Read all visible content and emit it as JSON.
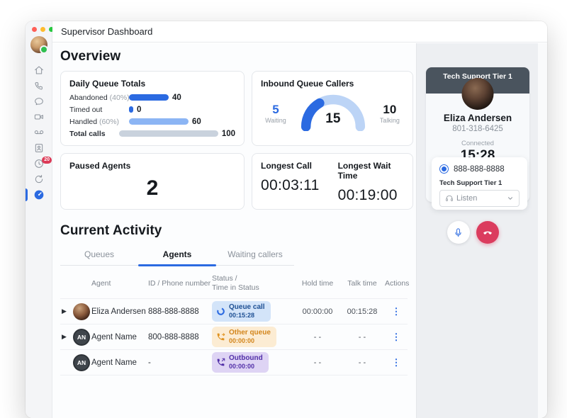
{
  "window": {
    "title": "Supervisor Dashboard"
  },
  "sidebar": {
    "history_badge": "20"
  },
  "overview": {
    "title": "Overview",
    "daily_queue": {
      "title": "Daily Queue Totals",
      "max": 100,
      "rows": [
        {
          "label": "Abandoned",
          "pct": "(40%)",
          "value": "40",
          "value_num": 40
        },
        {
          "label": "Timed out",
          "pct": "",
          "value": "0",
          "value_num": 0
        },
        {
          "label": "Handled",
          "pct": "(60%)",
          "value": "60",
          "value_num": 60
        },
        {
          "label": "Total calls",
          "pct": "",
          "value": "100",
          "value_num": 100
        }
      ]
    },
    "inbound": {
      "title": "Inbound Queue Callers",
      "waiting": "5",
      "waiting_label": "Waiting",
      "waiting_num": 5,
      "total": "15",
      "total_num": 15,
      "talking": "10",
      "talking_label": "Talking"
    },
    "paused": {
      "title": "Paused Agents",
      "value": "2"
    },
    "longest": {
      "call_label": "Longest Call",
      "call_value": "00:03:11",
      "wait_label": "Longest Wait Time",
      "wait_value": "00:19:00"
    }
  },
  "activity": {
    "title": "Current Activity",
    "tabs": {
      "queues": "Queues",
      "agents": "Agents",
      "waiting": "Waiting callers"
    },
    "columns": {
      "agent": "Agent",
      "phone": "ID / Phone number",
      "status": "Status /\nTime in Status",
      "hold": "Hold time",
      "talk": "Talk time",
      "actions": "Actions"
    },
    "rows": [
      {
        "agent": "Eliza Andersen",
        "phone": "888-888-8888",
        "status": "Queue call",
        "status_time": "00:15:28",
        "hold": "00:00:00",
        "talk": "00:15:28"
      },
      {
        "agent": "Agent Name",
        "initials": "AN",
        "phone": "800-888-8888",
        "status": "Other queue",
        "status_time": "00:00:00",
        "hold": "- -",
        "talk": "- -"
      },
      {
        "agent": "Agent Name",
        "initials": "AN",
        "phone": "-",
        "status": "Outbound",
        "status_time": "00:00:00",
        "hold": "- -",
        "talk": "- -"
      }
    ]
  },
  "call_panel": {
    "queue_name": "Tech Support Tier 1",
    "caller_name": "Eliza Andersen",
    "caller_number": "801-318-6425",
    "status_label": "Connected",
    "timer": "15:28",
    "line_number": "888-888-8888",
    "monitor_queue_label": "Tech Support Tier 1",
    "listen_label": "Listen"
  },
  "colors": {
    "accent_blue": "#2b6ae1",
    "light_blue_bar": "#8cb5f4",
    "gray_bar": "#c9d2dd",
    "gauge_light": "#bcd4f6",
    "badge_queue_bg": "#d3e4f9",
    "badge_other_bg": "#fcecd3",
    "badge_outbound_bg": "#ded4f4",
    "hangup_red": "#db3c5e",
    "panel_header_dark": "#4a545e"
  }
}
